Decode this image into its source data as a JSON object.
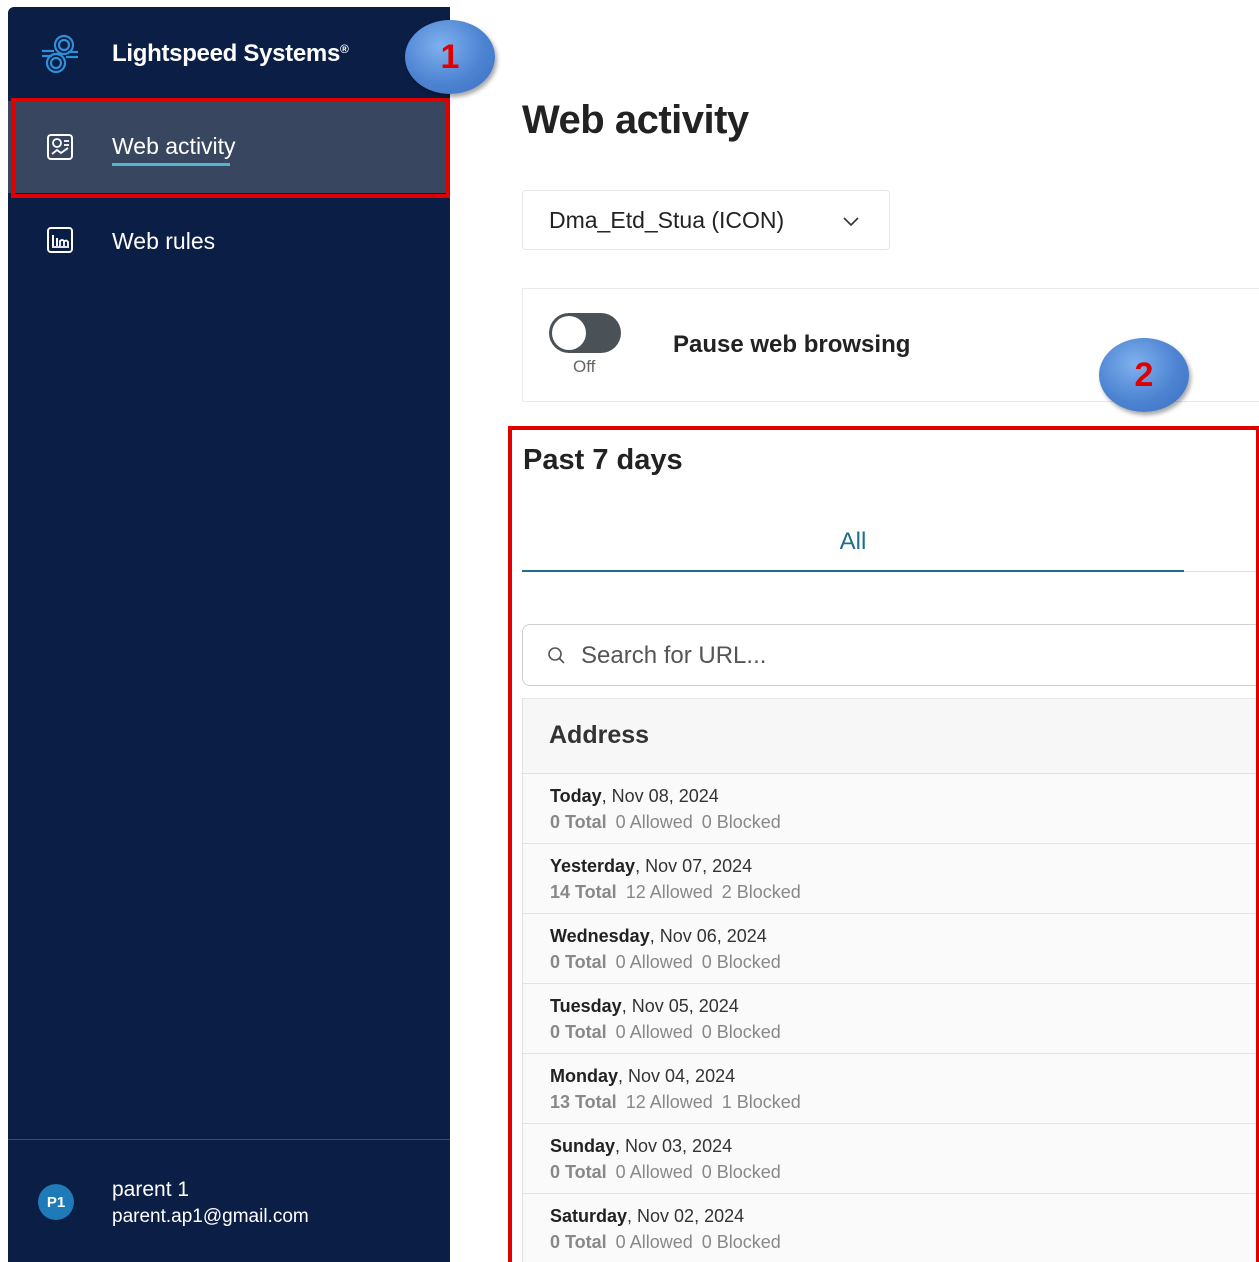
{
  "app": {
    "brand_name": "Lightspeed Systems",
    "brand_mark": "®"
  },
  "sidebar": {
    "items": [
      {
        "label": "Web activity",
        "icon": "web-activity-icon",
        "active": true
      },
      {
        "label": "Web rules",
        "icon": "web-rules-icon",
        "active": false
      }
    ],
    "user": {
      "initials": "P1",
      "name": "parent 1",
      "email": "parent.ap1@gmail.com"
    }
  },
  "callouts": [
    "1",
    "2"
  ],
  "main": {
    "title": "Web activity",
    "student_select": {
      "value": "Dma_Etd_Stua (ICON)"
    },
    "pause": {
      "label": "Pause web browsing",
      "state": "Off",
      "enabled": false
    },
    "section_title": "Past 7 days",
    "tabs": [
      {
        "label": "All",
        "active": true
      }
    ],
    "search": {
      "placeholder": "Search for URL..."
    },
    "table": {
      "header": "Address",
      "rows": [
        {
          "day": "Today",
          "date": ", Nov 08, 2024",
          "total": "0 Total",
          "allowed": "0 Allowed",
          "blocked": "0 Blocked"
        },
        {
          "day": "Yesterday",
          "date": ", Nov 07, 2024",
          "total": "14 Total",
          "allowed": "12 Allowed",
          "blocked": "2 Blocked"
        },
        {
          "day": "Wednesday",
          "date": ", Nov 06, 2024",
          "total": "0 Total",
          "allowed": "0 Allowed",
          "blocked": "0 Blocked"
        },
        {
          "day": "Tuesday",
          "date": ", Nov 05, 2024",
          "total": "0 Total",
          "allowed": "0 Allowed",
          "blocked": "0 Blocked"
        },
        {
          "day": "Monday",
          "date": ", Nov 04, 2024",
          "total": "13 Total",
          "allowed": "12 Allowed",
          "blocked": "1 Blocked"
        },
        {
          "day": "Sunday",
          "date": ", Nov 03, 2024",
          "total": "0 Total",
          "allowed": "0 Allowed",
          "blocked": "0 Blocked"
        },
        {
          "day": "Saturday",
          "date": ", Nov 02, 2024",
          "total": "0 Total",
          "allowed": "0 Allowed",
          "blocked": "0 Blocked"
        }
      ]
    }
  },
  "colors": {
    "sidebar_bg": "#0b1e45",
    "active_item_bg": "#39465f",
    "accent": "#1d6f8a",
    "highlight": "#e00000"
  }
}
